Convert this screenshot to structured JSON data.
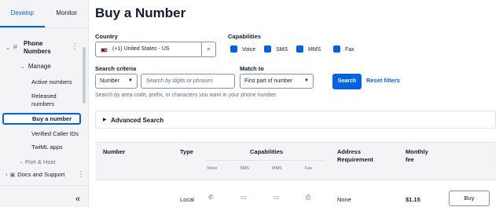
{
  "sidebar": {
    "tabs": [
      {
        "label": "Develop",
        "active": true
      },
      {
        "label": "Monitor",
        "active": false
      }
    ],
    "section_title": "Phone Numbers",
    "subsection": "Manage",
    "items": [
      {
        "label": "Active numbers"
      },
      {
        "label": "Released numbers"
      },
      {
        "label": "Buy a number",
        "active": true
      },
      {
        "label": "Verified Caller IDs"
      },
      {
        "label": "TwiML apps"
      }
    ],
    "port_host": "Port & Host",
    "docs_support": "Docs and Support"
  },
  "page": {
    "title": "Buy a Number",
    "country_label": "Country",
    "country_value": "(+1) United States - US",
    "capabilities_label": "Capabilities",
    "capabilities": [
      {
        "label": "Voice",
        "checked": true
      },
      {
        "label": "SMS",
        "checked": true
      },
      {
        "label": "MMS",
        "checked": true
      },
      {
        "label": "Fax",
        "checked": true
      }
    ],
    "search_criteria_label": "Search criteria",
    "search_criteria_value": "Number",
    "search_placeholder": "Search by digits or phrases",
    "match_to_label": "Match to",
    "match_to_value": "First part of number",
    "search_button": "Search",
    "reset_link": "Reset filters",
    "help_text": "Search by area code, prefix, or characters you want in your phone number.",
    "advanced_search": "Advanced Search"
  },
  "table": {
    "headers": {
      "number": "Number",
      "type": "Type",
      "capabilities": "Capabilities",
      "address": "Address Requirement",
      "fee": "Monthly fee"
    },
    "cap_subheaders": [
      "Voice",
      "SMS",
      "MMS",
      "Fax"
    ],
    "rows": [
      {
        "type": "Local",
        "address": "None",
        "fee": "$1.15",
        "action": "Buy"
      }
    ]
  },
  "colors": {
    "accent": "#0263e0"
  }
}
